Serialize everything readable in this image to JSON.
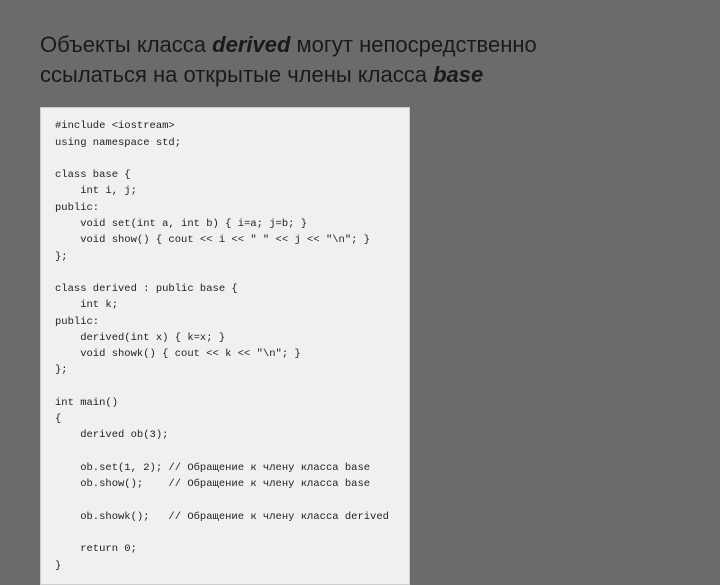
{
  "slide": {
    "title_part1": "Объекты класса ",
    "title_italic": "derived",
    "title_part2": " могут непосредственно",
    "title_line2": "ссылаться на открытые члены класса ",
    "title_italic2": "base"
  },
  "code": {
    "lines": [
      "#include <iostream>",
      "using namespace std;",
      "",
      "class base {",
      "    int i, j;",
      "public:",
      "    void set(int a, int b) { i=a; j=b; }",
      "    void show() { cout << i << \" \" << j << \"\\n\"; }",
      "};",
      "",
      "class derived : public base {",
      "    int k;",
      "public:",
      "    derived(int x) { k=x; }",
      "    void showk() { cout << k << \"\\n\"; }",
      "};",
      "",
      "int main()",
      "{",
      "    derived ob(3);",
      "",
      "    ob.set(1, 2); // Обращение к члену класса base",
      "    ob.show();    // Обращение к члену класса base",
      "",
      "    ob.showk();   // Обращение к члену класса derived",
      "",
      "    return 0;",
      "}"
    ]
  }
}
